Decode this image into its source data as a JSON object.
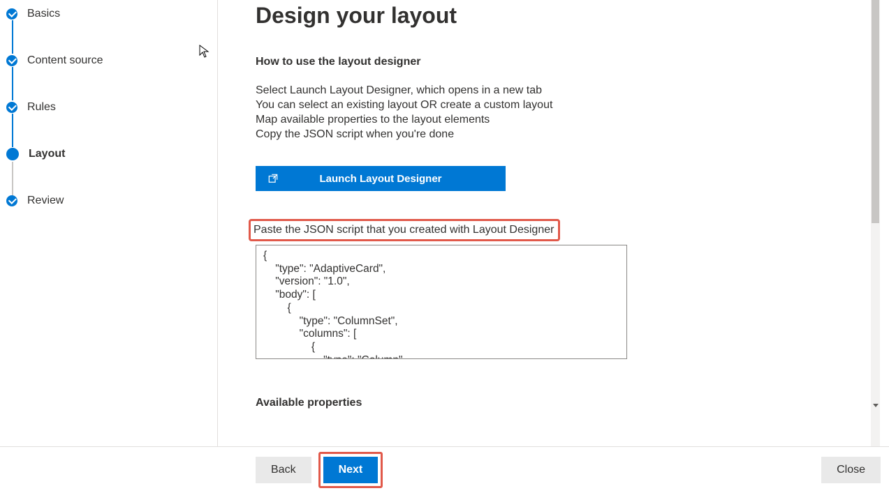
{
  "sidebar": {
    "steps": [
      {
        "label": "Basics",
        "state": "done"
      },
      {
        "label": "Content source",
        "state": "done"
      },
      {
        "label": "Rules",
        "state": "done"
      },
      {
        "label": "Layout",
        "state": "current"
      },
      {
        "label": "Review",
        "state": "pending"
      }
    ]
  },
  "main": {
    "title": "Design your layout",
    "howto_title": "How to use the layout designer",
    "instructions": [
      "Select Launch Layout Designer, which opens in a new tab",
      "You can select an existing layout OR create a custom layout",
      "Map available properties to the layout elements",
      "Copy the JSON script when you're done"
    ],
    "launch_button": "Launch Layout Designer",
    "json_label": "Paste the JSON script that you created with Layout Designer",
    "json_value": "{\n    \"type\": \"AdaptiveCard\",\n    \"version\": \"1.0\",\n    \"body\": [\n        {\n            \"type\": \"ColumnSet\",\n            \"columns\": [\n                {\n                    \"type\": \"Column\",",
    "available_props": "Available properties"
  },
  "footer": {
    "back": "Back",
    "next": "Next",
    "close": "Close"
  },
  "colors": {
    "primary": "#0078d4",
    "highlight_border": "#e1594a"
  }
}
